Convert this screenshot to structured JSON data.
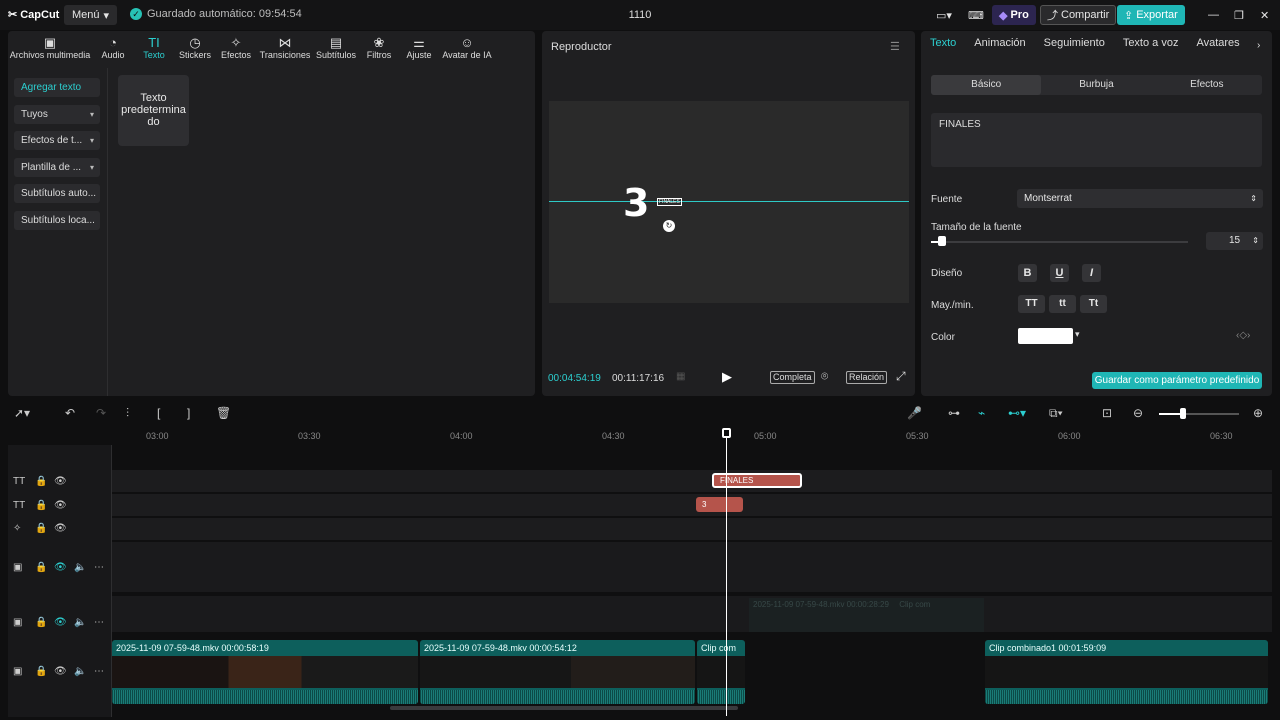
{
  "app": {
    "logo": "CapCut",
    "menu_label": "Menú",
    "autosave": "Guardado automático: 09:54:54",
    "project_title": "1110",
    "pro_label": "Pro",
    "share_label": "Compartir",
    "export_label": "Exportar"
  },
  "tool_tabs": [
    {
      "label": "Archivos multimedia",
      "icon": "media-icon"
    },
    {
      "label": "Audio",
      "icon": "audio-icon"
    },
    {
      "label": "Texto",
      "icon": "text-icon",
      "active": true
    },
    {
      "label": "Stickers",
      "icon": "sticker-icon"
    },
    {
      "label": "Efectos",
      "icon": "effects-icon"
    },
    {
      "label": "Transiciones",
      "icon": "transitions-icon"
    },
    {
      "label": "Subtítulos",
      "icon": "subtitles-icon"
    },
    {
      "label": "Filtros",
      "icon": "filters-icon"
    },
    {
      "label": "Ajuste",
      "icon": "adjust-icon"
    },
    {
      "label": "Avatar de IA",
      "icon": "ai-avatar-icon"
    }
  ],
  "sidebar": [
    {
      "label": "Agregar texto"
    },
    {
      "label": "Tuyos"
    },
    {
      "label": "Efectos de t..."
    },
    {
      "label": "Plantilla de ..."
    },
    {
      "label": "Subtítulos auto..."
    },
    {
      "label": "Subtítulos loca..."
    }
  ],
  "default_text_card": "Texto predetermina do",
  "player": {
    "title": "Reproductor",
    "big_text": "3",
    "small_text": "FINALES",
    "current_time": "00:04:54:19",
    "total_time": "00:11:17:16",
    "full_label": "Completa",
    "ratio_label": "Relación"
  },
  "props": {
    "tabs": [
      "Texto",
      "Animación",
      "Seguimiento",
      "Texto a voz",
      "Avatares"
    ],
    "subtabs": [
      "Básico",
      "Burbuja",
      "Efectos"
    ],
    "text_value": "FINALES",
    "font_label": "Fuente",
    "font_value": "Montserrat",
    "size_label": "Tamaño de la fuente",
    "size_value": "15",
    "design_label": "Diseño",
    "case_label": "May./min.",
    "case_options": [
      "TT",
      "tt",
      "Tt"
    ],
    "color_label": "Color",
    "color_value": "#ffffff",
    "save_preset": "Guardar como parámetro predefinido"
  },
  "timeline": {
    "ruler": [
      "03:00",
      "03:30",
      "04:00",
      "04:30",
      "05:00",
      "05:30",
      "06:00",
      "06:30"
    ],
    "text_clip_1": "FINALES",
    "text_clip_2": "3",
    "ghost_clip_1": "2025-11-09 07-59-48.mkv  00:00:28:29",
    "ghost_clip_2": "Clip com",
    "video_clips": [
      {
        "label": "2025-11-09 07-59-48.mkv   00:00:58:19"
      },
      {
        "label": "2025-11-09 07-59-48.mkv   00:00:54:12"
      },
      {
        "label": "Clip com"
      },
      {
        "label": "Clip combinado1   00:01:59:09"
      }
    ]
  }
}
